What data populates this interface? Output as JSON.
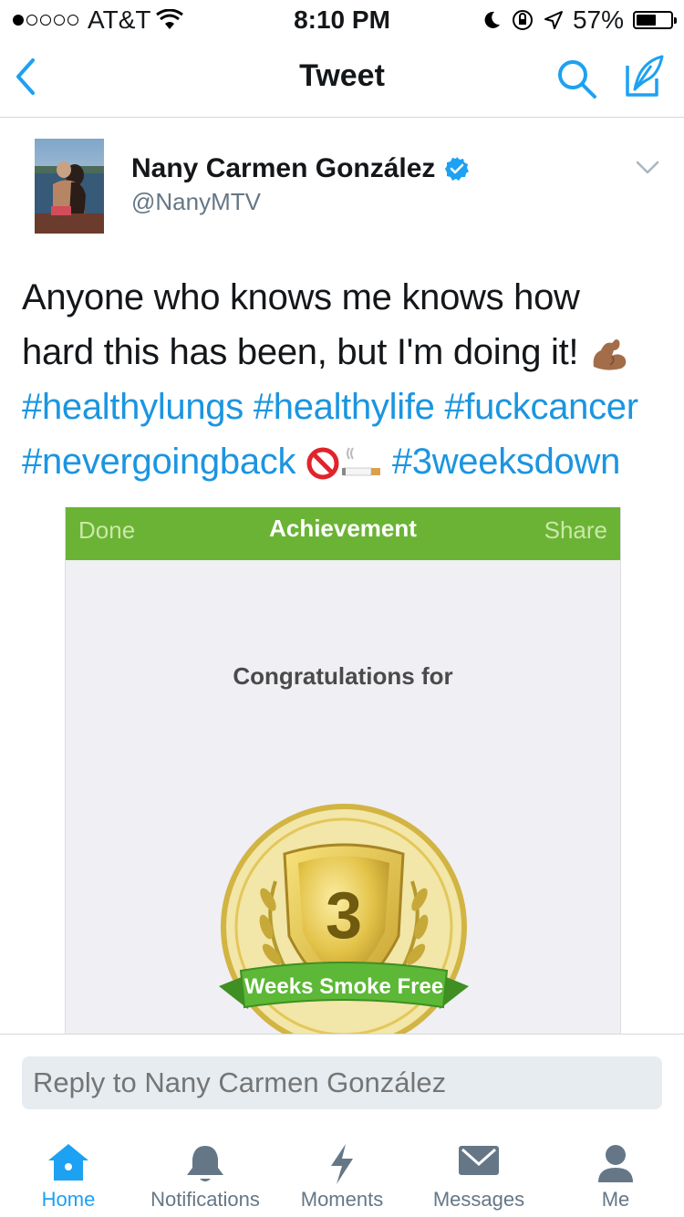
{
  "status_bar": {
    "carrier": "AT&T",
    "time": "8:10 PM",
    "battery_percent": "57%",
    "battery_level": 0.57,
    "signal_bars_filled": 1,
    "signal_bars_total": 5
  },
  "nav": {
    "title": "Tweet"
  },
  "tweet": {
    "author_name": "Nany Carmen González",
    "author_handle": "@NanyMTV",
    "verified": true,
    "text_line1": "Anyone who knows me knows how",
    "text_line2": "hard this has been, but I'm doing it! ",
    "hashtags_line3": [
      "#healthylungs",
      "#healthylife",
      "#fuckcancer"
    ],
    "hashtag_line4a": "#nevergoingback",
    "hashtag_line4b": "#3weeksdown",
    "emoji": [
      "flexed-biceps",
      "prohibited",
      "cigarette"
    ]
  },
  "media": {
    "done_label": "Done",
    "title": "Achievement",
    "share_label": "Share",
    "congrats_text": "Congratulations for",
    "badge_number": "3",
    "badge_ribbon": "Weeks Smoke Free",
    "bar_color": "#6bb335"
  },
  "reply": {
    "placeholder": "Reply to Nany Carmen González"
  },
  "tabs": [
    {
      "label": "Home",
      "icon": "home-icon",
      "active": true
    },
    {
      "label": "Notifications",
      "icon": "bell-icon",
      "active": false
    },
    {
      "label": "Moments",
      "icon": "lightning-icon",
      "active": false
    },
    {
      "label": "Messages",
      "icon": "envelope-icon",
      "active": false
    },
    {
      "label": "Me",
      "icon": "person-icon",
      "active": false
    }
  ],
  "colors": {
    "accent": "#1da1f2",
    "hashtag": "#1b95e0",
    "inactive_tab": "#657786"
  }
}
